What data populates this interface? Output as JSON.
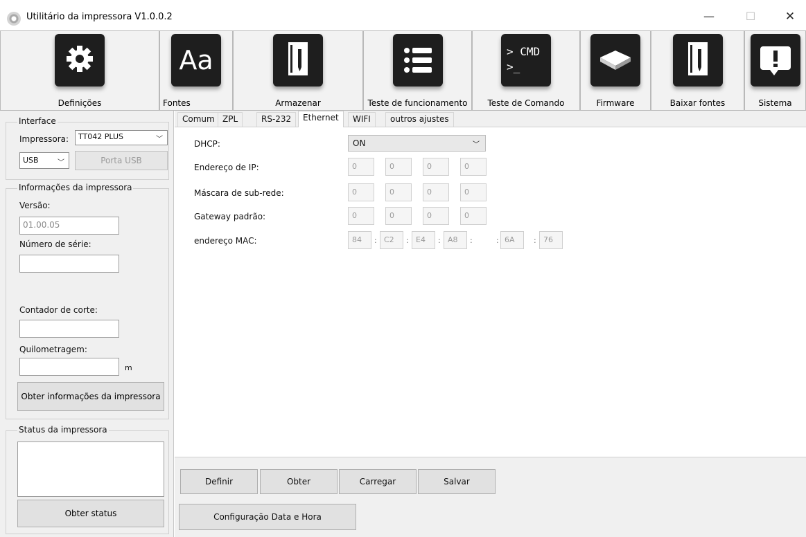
{
  "window": {
    "title": "Utilitário da impressora  V1.0.0.2",
    "min_symbol": "—",
    "max_symbol": "☐",
    "close_symbol": "✕"
  },
  "toolbar": {
    "items": [
      {
        "label": "Definições",
        "icon": "gear-icon"
      },
      {
        "label": "Fontes",
        "icon": "font-aa-icon"
      },
      {
        "label": "Armazenar",
        "icon": "notebook-icon"
      },
      {
        "label": "Teste de funcionamento",
        "icon": "list-icon"
      },
      {
        "label": "Teste de Comando",
        "icon": "cmd-icon"
      },
      {
        "label": "Firmware",
        "icon": "chip-icon"
      },
      {
        "label": "Baixar fontes",
        "icon": "notebook-icon"
      },
      {
        "label": "Sistema",
        "icon": "alert-icon"
      }
    ],
    "aa_text": "Aa",
    "cmd_line1": "> CMD",
    "cmd_line2": ">_"
  },
  "interface": {
    "title": "Interface",
    "printer_label": "Impressora:",
    "printer_value": "TT042 PLUS",
    "port_value": "USB",
    "port_button": "Porta USB"
  },
  "printer_info": {
    "title": "Informações da impressora",
    "version_label": "Versão:",
    "version_value": "01.00.05",
    "serial_label": "Número de série:",
    "serial_value": "",
    "cut_counter_label": "Contador de corte:",
    "cut_counter_value": "",
    "mileage_label": "Quilometragem:",
    "mileage_value": "",
    "mileage_unit": "m",
    "get_info_button": "Obter informações da impressora"
  },
  "printer_status": {
    "title": "Status da impressora",
    "status_text": "",
    "get_status_button": "Obter status"
  },
  "tabs": [
    {
      "label": "Comum"
    },
    {
      "label": "ZPL"
    },
    {
      "label": "RS-232"
    },
    {
      "label": "Ethernet",
      "active": true
    },
    {
      "label": "WIFI"
    },
    {
      "label": "outros ajustes"
    }
  ],
  "ethernet": {
    "dhcp_label": "DHCP:",
    "dhcp_value": "ON",
    "ip_label": "Endereço de IP:",
    "ip": [
      "0",
      "0",
      "0",
      "0"
    ],
    "mask_label": "Máscara de sub-rede:",
    "mask": [
      "0",
      "0",
      "0",
      "0"
    ],
    "gateway_label": "Gateway padrão:",
    "gateway": [
      "0",
      "0",
      "0",
      "0"
    ],
    "mac_label": "endereço MAC:",
    "mac": [
      "84",
      "C2",
      "E4",
      "A8",
      "6A",
      "76"
    ],
    "mac_sep": ":"
  },
  "actions": {
    "set": "Definir",
    "get": "Obter",
    "load": "Carregar",
    "save": "Salvar",
    "datetime": "Configuração Data e Hora"
  }
}
